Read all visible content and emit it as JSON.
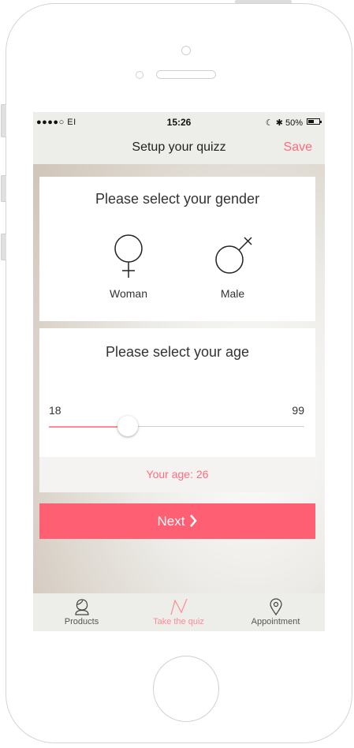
{
  "status_bar": {
    "carrier": "●●●●○ EI",
    "time": "15:26",
    "battery_text": "☾ ✱ 50%",
    "battery_level": 0.5
  },
  "nav": {
    "title": "Setup your quizz",
    "save_label": "Save"
  },
  "gender": {
    "title": "Please select your gender",
    "options": [
      {
        "label": "Woman",
        "icon": "female-symbol-icon"
      },
      {
        "label": "Male",
        "icon": "male-symbol-icon"
      }
    ]
  },
  "age": {
    "title": "Please select your age",
    "min_label": "18",
    "max_label": "99",
    "min": 18,
    "max": 99,
    "value": 26,
    "readout": "Your age: 26"
  },
  "next_label": "Next",
  "tabs": [
    {
      "label": "Products",
      "icon": "person-icon",
      "active": false
    },
    {
      "label": "Take the quiz",
      "icon": "zigzag-icon",
      "active": true
    },
    {
      "label": "Appointment",
      "icon": "location-pin-icon",
      "active": false
    }
  ],
  "colors": {
    "accent": "#ff5f73",
    "accent_text": "#ff6b7d"
  }
}
